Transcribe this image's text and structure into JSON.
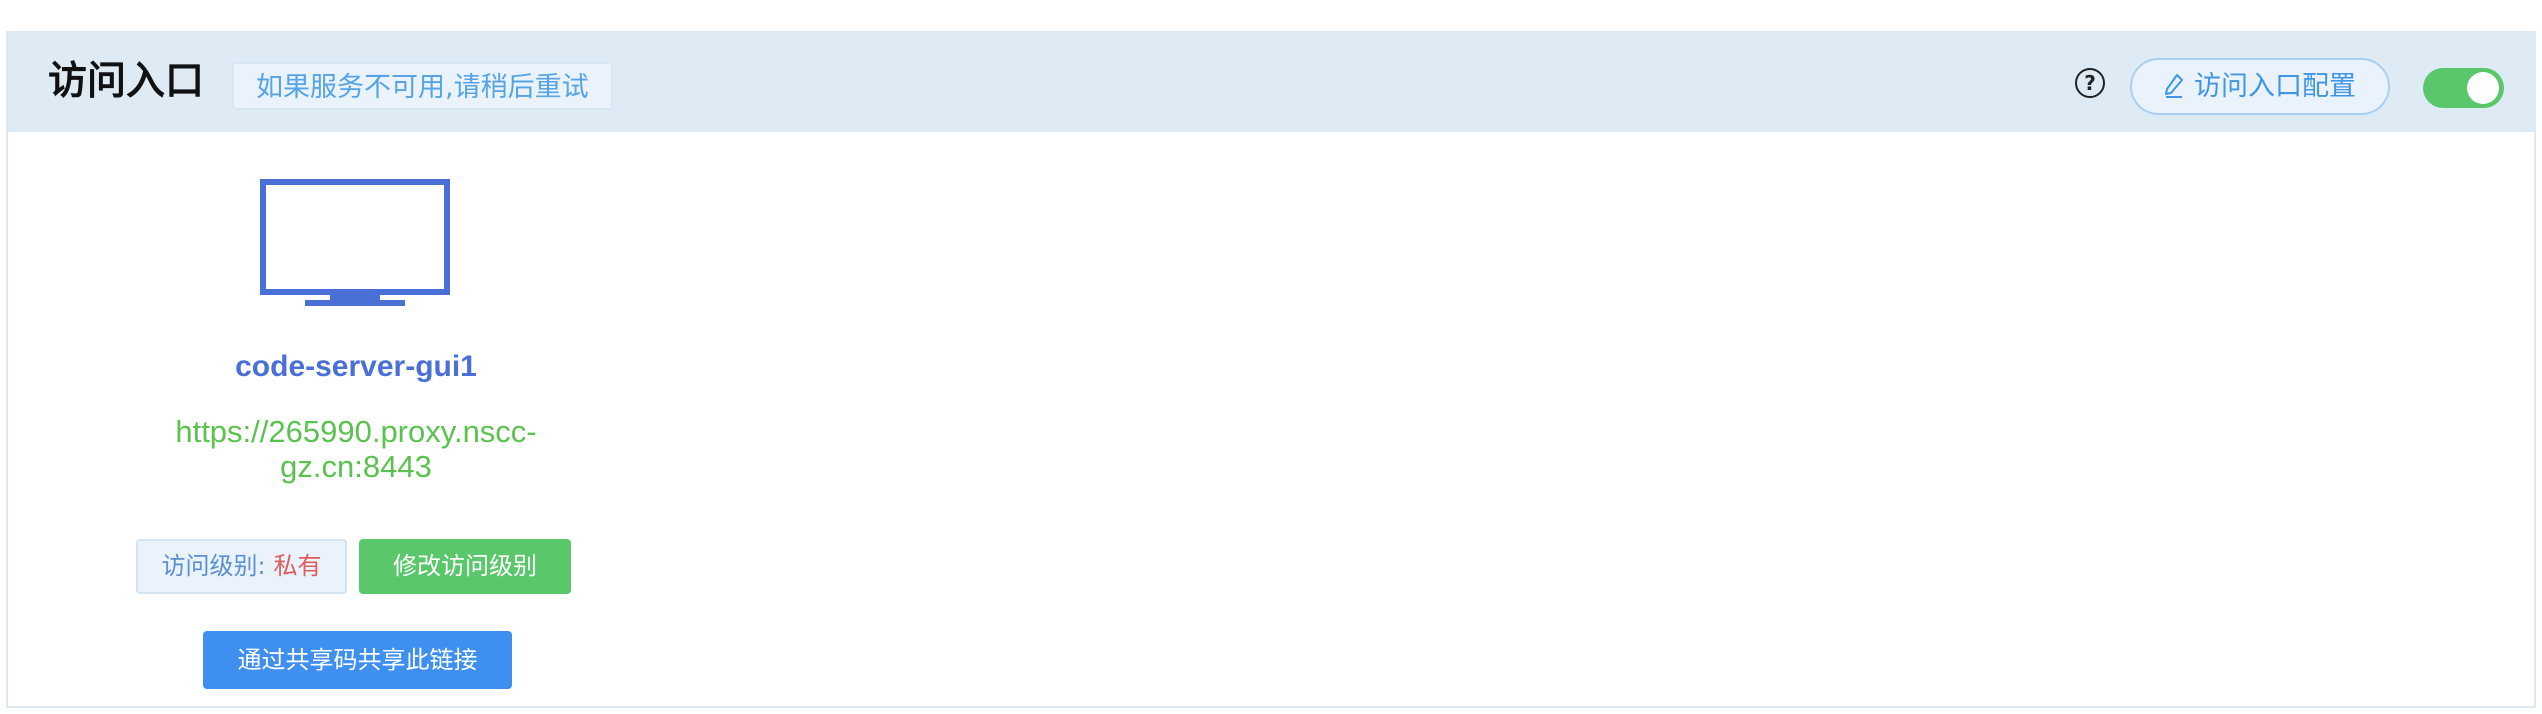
{
  "header": {
    "title": "访问入口",
    "hint": "如果服务不可用,请稍后重试",
    "help_glyph": "?",
    "config_button_label": "访问入口配置",
    "toggle_on": true,
    "accent_color": "#59c76a"
  },
  "entry": {
    "icon": "monitor-icon",
    "name": "code-server-gui1",
    "url_line1": "https://265990.proxy.nscc-",
    "url_line2": "gz.cn:8443",
    "access_level_label": "访问级别:",
    "access_level_value": "私有",
    "modify_button_label": "修改访问级别",
    "share_button_label": "通过共享码共享此链接"
  }
}
